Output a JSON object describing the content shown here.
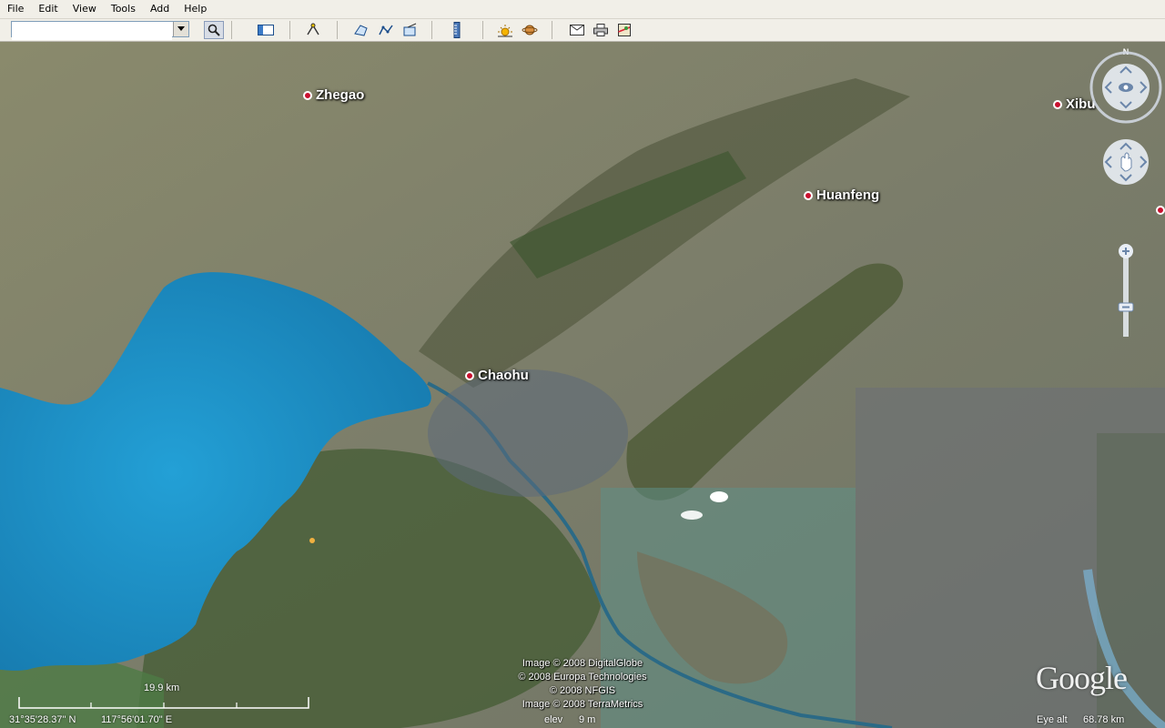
{
  "menu": [
    "File",
    "Edit",
    "View",
    "Tools",
    "Add",
    "Help"
  ],
  "search": {
    "value": "",
    "placeholder": ""
  },
  "toolbar_icons": [
    "search-icon",
    "sidebar-toggle-icon",
    "placemark-icon",
    "polygon-icon",
    "path-icon",
    "image-overlay-icon",
    "ruler-icon",
    "sun-icon",
    "planet-icon",
    "email-icon",
    "print-icon",
    "maps-icon"
  ],
  "places": [
    {
      "name": "Zhegao"
    },
    {
      "name": "Chaohu"
    },
    {
      "name": "Huanfeng"
    },
    {
      "name": "Xibu"
    }
  ],
  "credits": [
    "Image © 2008 DigitalGlobe",
    "© 2008 Europa Technologies",
    "© 2008 NFGIS",
    "Image © 2008 TerraMetrics"
  ],
  "scale": {
    "label": "19.9 km"
  },
  "status": {
    "lat": "31°35'28.37\" N",
    "lon": "117°56'01.70\" E",
    "elev_label": "elev",
    "elev_value": "9 m",
    "eye_label": "Eye alt",
    "eye_value": "68.78 km"
  },
  "compass": {
    "north": "N"
  },
  "logo": "Google",
  "colors": {
    "lake": "#1e8fc4",
    "pin": "#c8102e",
    "toolbar": "#f1efe8"
  }
}
